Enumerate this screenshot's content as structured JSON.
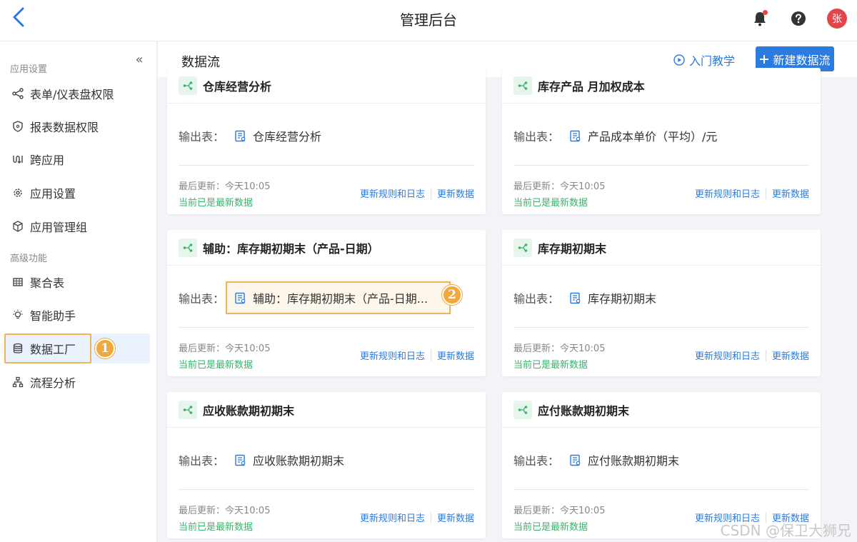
{
  "topbar": {
    "title": "管理后台",
    "avatar_text": "张"
  },
  "sidebar": {
    "section_app": "应用设置",
    "section_adv": "高级功能",
    "items_app": [
      {
        "label": "表单/仪表盘权限",
        "icon": "share-nodes-icon"
      },
      {
        "label": "报表数据权限",
        "icon": "shield-icon"
      },
      {
        "label": "跨应用",
        "icon": "cross-app-icon"
      },
      {
        "label": "应用设置",
        "icon": "gear-icon"
      },
      {
        "label": "应用管理组",
        "icon": "cube-icon"
      }
    ],
    "items_adv": [
      {
        "label": "聚合表",
        "icon": "grid-table-icon"
      },
      {
        "label": "智能助手",
        "icon": "lightbulb-icon"
      },
      {
        "label": "数据工厂",
        "icon": "database-icon"
      },
      {
        "label": "流程分析",
        "icon": "flow-chart-icon"
      }
    ]
  },
  "main": {
    "title": "数据流",
    "tutorial_label": "入门教学",
    "new_button_label": "新建数据流",
    "output_label": "输出表：",
    "update_time": "最后更新：今天10:05",
    "status": "当前已是最新数据",
    "action_rules": "更新规则和日志",
    "action_update": "更新数据",
    "cards": [
      {
        "title": "仓库经营分析",
        "output": "仓库经营分析"
      },
      {
        "title": "库存产品 月加权成本",
        "output": "产品成本单价（平均）/元"
      },
      {
        "title": "辅助：库存期初期末（产品-日期）",
        "output": "辅助：库存期初期末（产品-日期..."
      },
      {
        "title": "库存期初期末",
        "output": "库存期初期末"
      },
      {
        "title": "应收账款期初期末",
        "output": "应收账款期初期末"
      },
      {
        "title": "应付账款期初期末",
        "output": "应付账款期初期末"
      }
    ]
  },
  "annotations": {
    "badge_1": "1",
    "badge_2": "2"
  },
  "watermark": "CSDN @保卫大狮兄",
  "colors": {
    "accent": "#2b7be0",
    "highlight": "#f0b25a",
    "status_green": "#3bb36d",
    "avatar": "#e1464a"
  }
}
